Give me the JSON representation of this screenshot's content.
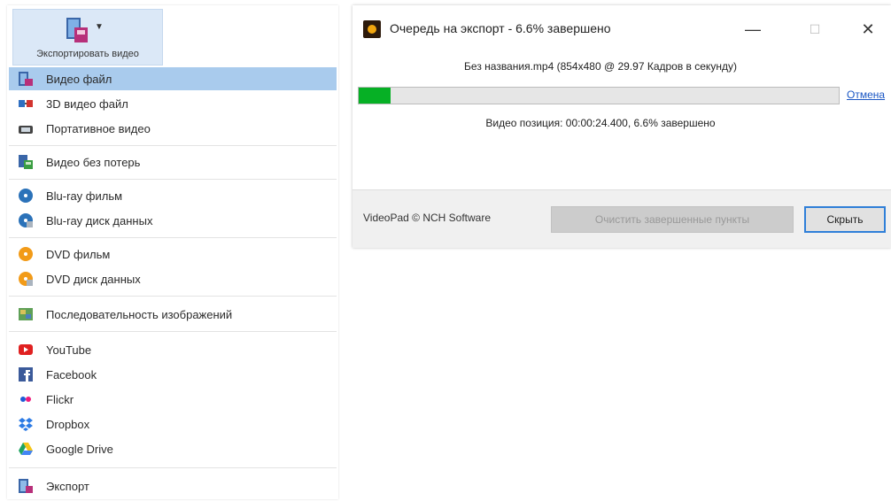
{
  "menu": {
    "toolbar_button_label": "Экспортировать видео",
    "items": [
      {
        "label": "Видео файл",
        "icon": "video-file-icon"
      },
      {
        "label": "3D видео файл",
        "icon": "3d-video-icon"
      },
      {
        "label": "Портативное видео",
        "icon": "portable-device-icon"
      },
      {
        "label": "Видео без потерь",
        "icon": "lossless-video-icon"
      },
      {
        "label": "Blu-ray фильм",
        "icon": "bluray-disc-icon"
      },
      {
        "label": "Blu-ray диск данных",
        "icon": "bluray-data-disc-icon"
      },
      {
        "label": "DVD фильм",
        "icon": "dvd-disc-icon"
      },
      {
        "label": "DVD диск данных",
        "icon": "dvd-data-disc-icon"
      },
      {
        "label": "Последовательность изображений",
        "icon": "image-sequence-icon"
      },
      {
        "label": "YouTube",
        "icon": "youtube-icon"
      },
      {
        "label": "Facebook",
        "icon": "facebook-icon"
      },
      {
        "label": "Flickr",
        "icon": "flickr-icon"
      },
      {
        "label": "Dropbox",
        "icon": "dropbox-icon"
      },
      {
        "label": "Google Drive",
        "icon": "google-drive-icon"
      },
      {
        "label": "Экспорт",
        "icon": "export-icon"
      }
    ]
  },
  "queue": {
    "title": "Очередь на экспорт - 6.6% завершено",
    "file_info": "Без названия.mp4 (854x480 @ 29.97 Кадров в секунду)",
    "progress": 0.066,
    "cancel_label": "Отмена",
    "position_text": "Видео позиция:  00:00:24.400, 6.6% завершено",
    "footer_text": "VideoPad © NCH Software",
    "clear_button": "Очистить завершенные пункты",
    "hide_button": "Скрыть",
    "window_buttons": {
      "minimize": "—",
      "maximize": "☐",
      "close": "✕"
    }
  },
  "colors": {
    "selection": "#a9cbed",
    "progress_fill": "#06b025",
    "link": "#1a56c4",
    "default_button_border": "#2f7fd8"
  }
}
